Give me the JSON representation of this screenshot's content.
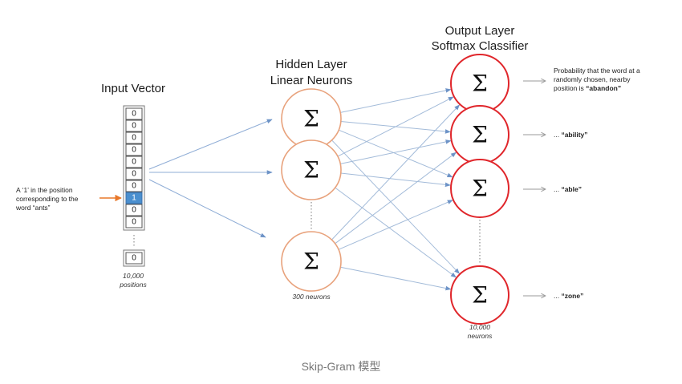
{
  "colors": {
    "hidden_neuron": "#e8a27c",
    "output_neuron": "#e0262b",
    "connection": "#a3bbd9",
    "highlight_cell": "#4a8fcf",
    "annotation_arrow": "#e8782a"
  },
  "input": {
    "title": "Input Vector",
    "cells": [
      "0",
      "0",
      "0",
      "0",
      "0",
      "0",
      "0",
      "1",
      "0",
      "0"
    ],
    "last_cell": "0",
    "size_line1": "10,000",
    "size_line2": "positions",
    "annotation": [
      "A ‘1’ in the position",
      "corresponding to the",
      "word “ants”"
    ]
  },
  "hidden": {
    "title_line1": "Hidden Layer",
    "title_line2": "Linear Neurons",
    "neuron_symbol": "Σ",
    "size_label": "300 neurons"
  },
  "output": {
    "title_line1": "Output Layer",
    "title_line2": "Softmax Classifier",
    "neuron_symbol": "Σ",
    "size_line1": "10,000",
    "size_line2": "neurons",
    "labels": [
      {
        "lines": [
          "Probability that the word at a",
          "randomly chosen, nearby",
          "position is "
        ],
        "word": "“abandon”"
      },
      {
        "prefix": "... ",
        "word": "“ability”"
      },
      {
        "prefix": "... ",
        "word": "“able”"
      },
      {
        "prefix": "... ",
        "word": "“zone”"
      }
    ]
  },
  "caption": "Skip-Gram 模型"
}
